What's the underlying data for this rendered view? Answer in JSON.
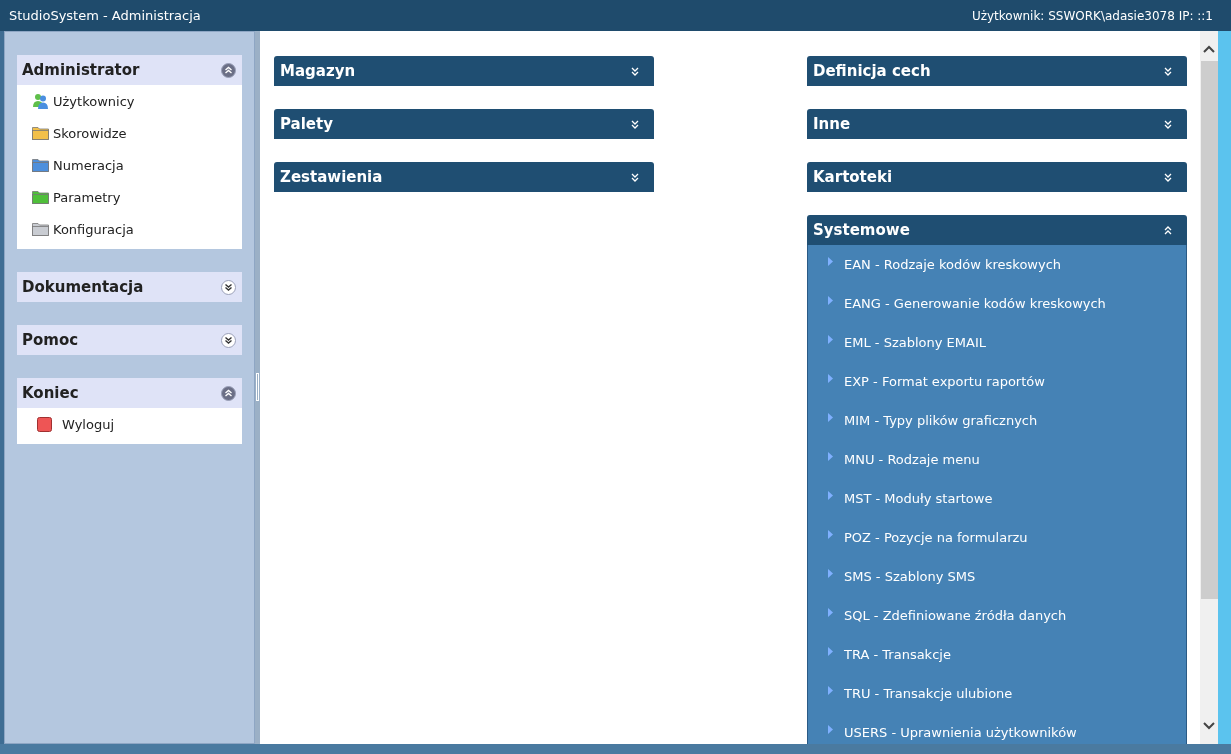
{
  "window": {
    "title": "StudioSystem - Administracja",
    "user_info": "Użytkownik: SSWORK\\adasie3078 IP: ::1"
  },
  "sidebar": {
    "sections": [
      {
        "title": "Administrator",
        "expanded": true,
        "items": [
          {
            "label": "Użytkownicy",
            "kind": "users"
          },
          {
            "label": "Skorowidze",
            "kind": "folder",
            "color": "#f2c04a"
          },
          {
            "label": "Numeracja",
            "kind": "folder",
            "color": "#4d8fdc"
          },
          {
            "label": "Parametry",
            "kind": "folder",
            "color": "#4fbf3a"
          },
          {
            "label": "Konfiguracja",
            "kind": "folder",
            "color": "#c9ccd2"
          }
        ]
      },
      {
        "title": "Dokumentacja",
        "expanded": false
      },
      {
        "title": "Pomoc",
        "expanded": false
      },
      {
        "title": "Koniec",
        "expanded": true,
        "items": [
          {
            "label": "Wyloguj",
            "kind": "square",
            "color": "#ee5555"
          }
        ]
      }
    ]
  },
  "columns": [
    [
      {
        "title": "Magazyn",
        "expanded": false
      },
      {
        "title": "Palety",
        "expanded": false
      },
      {
        "title": "Zestawienia",
        "expanded": false
      }
    ],
    [
      {
        "title": "Definicja cech",
        "expanded": false
      },
      {
        "title": "Inne",
        "expanded": false
      },
      {
        "title": "Kartoteki",
        "expanded": false
      },
      {
        "title": "Systemowe",
        "expanded": true,
        "items": [
          "EAN - Rodzaje kodów kreskowych",
          "EANG - Generowanie kodów kreskowych",
          "EML - Szablony EMAIL",
          "EXP - Format exportu raportów",
          "MIM - Typy plików graficznych",
          "MNU - Rodzaje menu",
          "MST - Moduły startowe",
          "POZ - Pozycje na formularzu",
          "SMS - Szablony SMS",
          "SQL - Zdefiniowane źródła danych",
          "TRA - Transakcje",
          "TRU - Transakcje ulubione",
          "USERS - Uprawnienia użytkowników"
        ]
      }
    ]
  ]
}
